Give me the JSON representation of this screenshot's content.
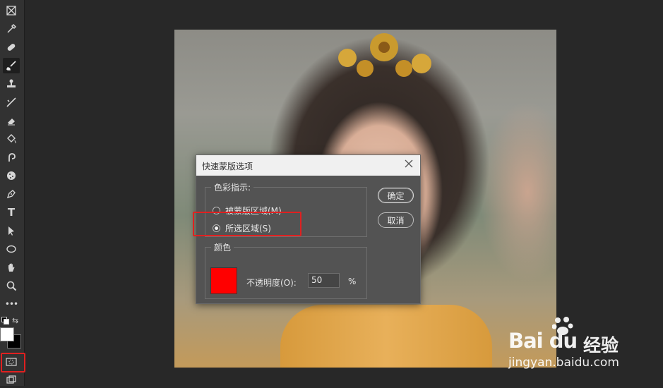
{
  "dialog": {
    "title": "快速蒙版选项",
    "group_color_indicates": "色彩指示:",
    "radio_masked": "被蒙版区域(M)",
    "radio_selected": "所选区域(S)",
    "selected_option": "所选区域(S)",
    "group_color": "颜色",
    "opacity_label": "不透明度(O):",
    "opacity_value": "50",
    "opacity_unit": "%",
    "mask_color": "#ff0000",
    "ok_label": "确定",
    "cancel_label": "取消"
  },
  "toolbar": {
    "tools": [
      "crop-icon",
      "eyedropper-icon",
      "healing-brush-icon",
      "brush-icon",
      "clone-stamp-icon",
      "history-brush-icon",
      "eraser-icon",
      "paint-bucket-icon",
      "smudge-icon",
      "sponge-icon",
      "pen-icon",
      "type-icon",
      "path-select-icon",
      "ellipse-icon",
      "hand-icon",
      "zoom-icon",
      "more-icon"
    ],
    "type_tool_glyph": "T",
    "more_glyph": "•••",
    "foreground_color": "#ffffff",
    "background_color": "#000000",
    "highlight_color": "#e02020"
  },
  "watermark": {
    "logo": "Bai du",
    "cn": "经验",
    "url": "jingyan.baidu.com"
  }
}
